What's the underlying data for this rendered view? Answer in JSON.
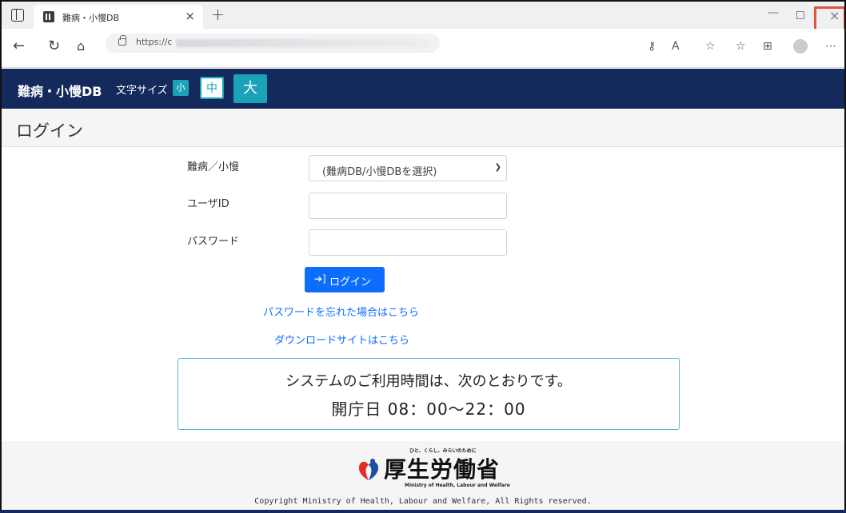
{
  "browser": {
    "tab_title": "難病・小慢DB",
    "tab_close": "×",
    "new_tab": "+",
    "url": "https://c",
    "window": {
      "minimize": "—",
      "close": "×"
    },
    "accent_close_highlight": "#e5533d"
  },
  "header": {
    "brand": "難病・小慢DB",
    "fontsize_label": "文字サイズ",
    "fontsize_small": "小",
    "fontsize_medium": "中",
    "fontsize_large": "大",
    "bg_color": "#142a5c"
  },
  "page": {
    "title": "ログイン"
  },
  "form": {
    "db_label": "難病／小慢",
    "db_select_value": "(難病DB/小慢DBを選択)",
    "user_label": "ユーザID",
    "user_value": "",
    "password_label": "パスワード",
    "password_value": "",
    "login_button": "ログイン",
    "forgot_link": "パスワードを忘れた場合はこちら",
    "download_link": "ダウンロードサイトはこちら"
  },
  "notice": {
    "line1": "システムのご利用時間は、次のとおりです。",
    "line2": "開庁日 08：00～22：00"
  },
  "footer": {
    "tagline": "ひと、くらし、みらいのために",
    "ministry_name": "厚生労働省",
    "ministry_en": "Ministry of Health, Labour and Welfare",
    "copyright": "Copyright Ministry of Health, Labour and Welfare, All Rights reserved."
  }
}
